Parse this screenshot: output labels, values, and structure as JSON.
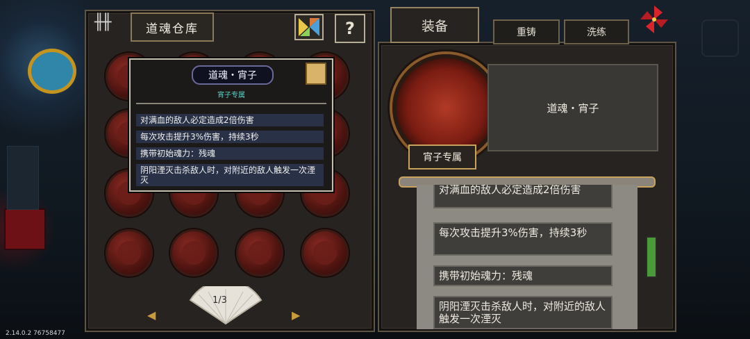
{
  "version": "2.14.0.2 76758477",
  "left_panel": {
    "title": "道魂仓库",
    "page": "1/3",
    "slots": 16
  },
  "tabs": [
    "装备",
    "重铸",
    "洗练"
  ],
  "tooltip": {
    "title": "道魂・宵子",
    "subtitle": "宵子专属",
    "effects": [
      "对满血的敌人必定造成2倍伤害",
      "每次攻击提升3%伤害，持续3秒",
      "携带初始魂力：残魂",
      "阴阳湮灭击杀敌人时，对附近的敌人触发一次湮灭"
    ]
  },
  "detail": {
    "name": "道魂・宵子",
    "exclusive": "宵子专属",
    "effects": [
      "对满血的敌人必定造成2倍伤害",
      "每次攻击提升3%伤害，持续3秒",
      "携带初始魂力：残魂",
      "阴阳湮灭击杀敌人时，对附近的敌人触发一次湮灭"
    ]
  },
  "icons": {
    "palette": "tangram-icon",
    "help": "?",
    "pinwheel": "pinwheel-icon",
    "left_arrow": "◀",
    "right_arrow": "▶"
  },
  "colors": {
    "panel_bg": "#262320",
    "gold": "#c9a25e",
    "soul_red": "#8a2a22",
    "tooltip_row": "#283146",
    "exclusive_text": "#5fd0c8"
  }
}
